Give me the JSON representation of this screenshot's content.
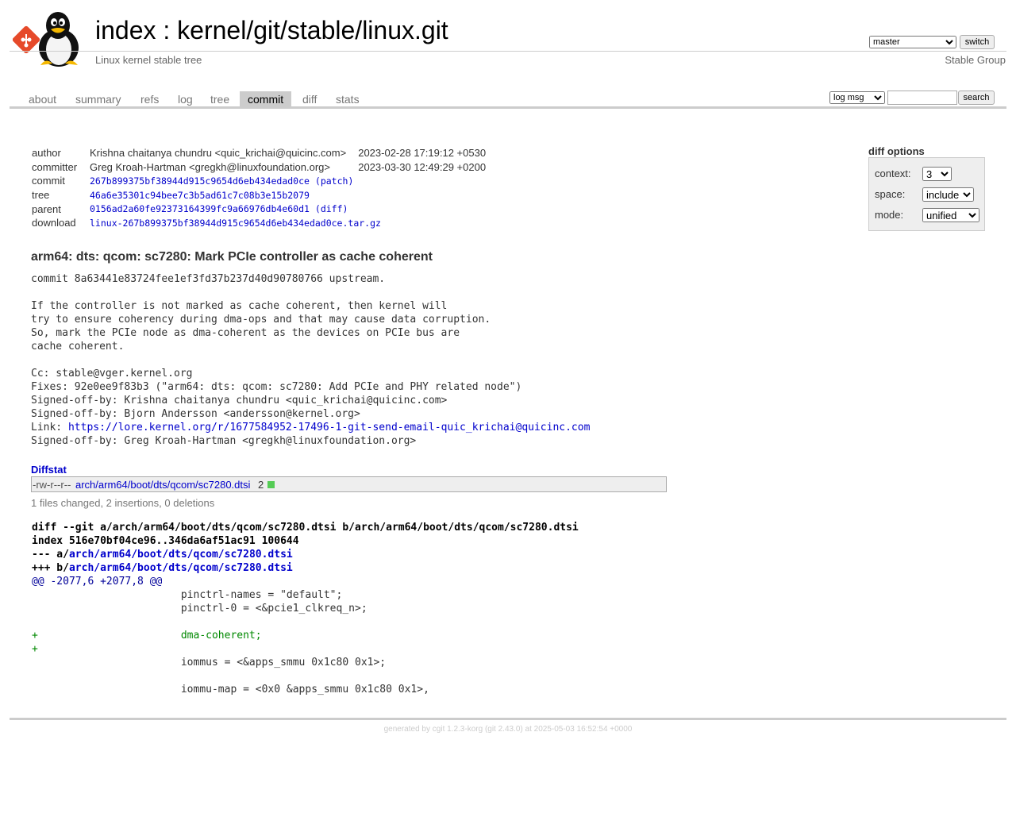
{
  "header": {
    "title_index": "index",
    "title_sep": " : ",
    "title_repo": "kernel/git/stable/linux.git",
    "description": "Linux kernel stable tree",
    "owner": "Stable Group",
    "branch_selected": "master",
    "switch_label": "switch"
  },
  "tabs": [
    {
      "label": "about"
    },
    {
      "label": "summary"
    },
    {
      "label": "refs"
    },
    {
      "label": "log"
    },
    {
      "label": "tree"
    },
    {
      "label": "commit",
      "active": true
    },
    {
      "label": "diff"
    },
    {
      "label": "stats"
    }
  ],
  "search": {
    "mode_selected": "log msg",
    "query": "",
    "button_label": "search"
  },
  "commit_info": {
    "author_label": "author",
    "author": "Krishna chaitanya chundru <quic_krichai@quicinc.com>",
    "author_date": "2023-02-28 17:19:12 +0530",
    "committer_label": "committer",
    "committer": "Greg Kroah-Hartman <gregkh@linuxfoundation.org>",
    "committer_date": "2023-03-30 12:49:29 +0200",
    "commit_label": "commit",
    "commit_hash": "267b899375bf38944d915c9654d6eb434edad0ce",
    "commit_link": "patch",
    "tree_label": "tree",
    "tree_hash": "46a6e35301c94bee7c3b5ad61c7c08b3e15b2079",
    "parent_label": "parent",
    "parent_hash": "0156ad2a60fe92373164399fc9a66976db4e60d1",
    "parent_link": "diff",
    "download_label": "download",
    "download_file": "linux-267b899375bf38944d915c9654d6eb434edad0ce.tar.gz"
  },
  "diff_options": {
    "title": "diff options",
    "context_label": "context:",
    "context_value": "3",
    "space_label": "space:",
    "space_value": "include",
    "mode_label": "mode:",
    "mode_value": "unified"
  },
  "commit_subject": "arm64: dts: qcom: sc7280: Mark PCIe controller as cache coherent",
  "commit_message": {
    "upstream": "commit 8a63441e83724fee1ef3fd37b237d40d90780766 upstream.",
    "body_1": "If the controller is not marked as cache coherent, then kernel will",
    "body_2": "try to ensure coherency during dma-ops and that may cause data corruption.",
    "body_3": "So, mark the PCIe node as dma-coherent as the devices on PCIe bus are",
    "body_4": "cache coherent.",
    "cc": "Cc: stable@vger.kernel.org",
    "fixes": "Fixes: 92e0ee9f83b3 (\"arm64: dts: qcom: sc7280: Add PCIe and PHY related node\")",
    "sob_1": "Signed-off-by: Krishna chaitanya chundru <quic_krichai@quicinc.com>",
    "sob_2": "Signed-off-by: Bjorn Andersson <andersson@kernel.org>",
    "link_prefix": "Link: ",
    "link_url": "https://lore.kernel.org/r/1677584952-17496-1-git-send-email-quic_krichai@quicinc.com",
    "sob_3": "Signed-off-by: Greg Kroah-Hartman <gregkh@linuxfoundation.org>"
  },
  "diffstat": {
    "header": "Diffstat",
    "mode": "-rw-r--r--",
    "file": "arch/arm64/boot/dts/qcom/sc7280.dtsi",
    "count": "2",
    "insertions_bar": 2,
    "summary": "1 files changed, 2 insertions, 0 deletions",
    "bar_color": "#55cc55"
  },
  "diff": {
    "header_1": "diff --git a/arch/arm64/boot/dts/qcom/sc7280.dtsi b/arch/arm64/boot/dts/qcom/sc7280.dtsi",
    "header_2": "index 516e70bf04ce96..346da6af51ac91 100644",
    "minus_prefix": "--- a/",
    "minus_file": "arch/arm64/boot/dts/qcom/sc7280.dtsi",
    "plus_prefix": "+++ b/",
    "plus_file": "arch/arm64/boot/dts/qcom/sc7280.dtsi",
    "hunk": "@@ -2077,6 +2077,8 @@",
    "line_1": " \t\t\tpinctrl-names = \"default\";",
    "line_2": " \t\t\tpinctrl-0 = <&pcie1_clkreq_n>;",
    "line_3": " ",
    "line_4": "+\t\t\tdma-coherent;",
    "line_5": "+",
    "line_6": " \t\t\tiommus = <&apps_smmu 0x1c80 0x1>;",
    "line_7": " ",
    "line_8": " \t\t\tiommu-map = <0x0 &apps_smmu 0x1c80 0x1>,"
  },
  "footer": {
    "prefix": "generated by ",
    "cgit": "cgit 1.2.3-korg",
    "git": "(git 2.43.0)",
    "suffix": " at 2025-05-03 16:52:54 +0000"
  },
  "colors": {
    "accent_link": "#0000cc",
    "tab_active_bg": "#cccccc",
    "add_line": "#008800",
    "hunk_line": "#000099"
  }
}
